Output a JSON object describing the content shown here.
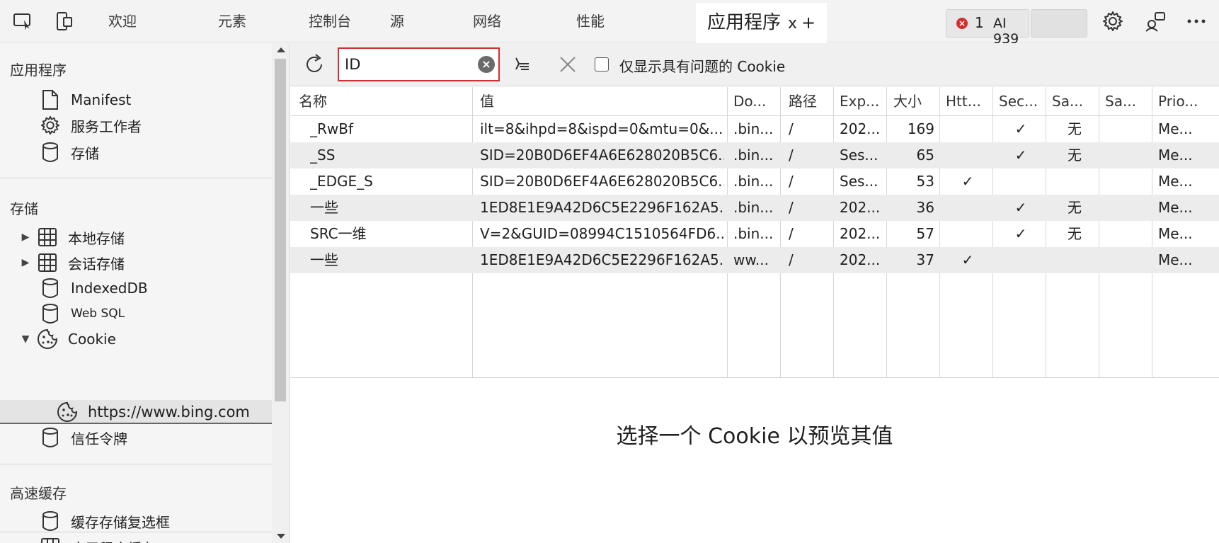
{
  "topbar": {
    "tabs": [
      {
        "label": "欢迎"
      },
      {
        "label": "元素"
      },
      {
        "label": "控制台"
      },
      {
        "label": "源"
      },
      {
        "label": "网络"
      },
      {
        "label": "性能"
      }
    ],
    "active_tab": {
      "label": "应用程序",
      "close": "x",
      "add": "+"
    },
    "errors_count": "1",
    "ai_label": "AI 939",
    "icons": [
      "inspect-icon",
      "device-emulation-icon",
      "error-icon",
      "settings-icon",
      "feedback-icon",
      "more-icon"
    ]
  },
  "sidebar": {
    "app_section": "应用程序",
    "app_items": [
      {
        "label": "Manifest",
        "icon": "file-icon"
      },
      {
        "label": "服务工作者",
        "icon": "gear-icon"
      },
      {
        "label": "存储",
        "icon": "database-icon"
      }
    ],
    "storage_section": "存储",
    "storage_items": [
      {
        "label": "本地存储",
        "icon": "grid-icon",
        "caret": "▶"
      },
      {
        "label": "会话存储",
        "icon": "grid-icon",
        "caret": "▶"
      },
      {
        "label": "IndexedDB",
        "icon": "database-icon"
      },
      {
        "label": "Web SQL",
        "icon": "database-icon"
      },
      {
        "label": "Cookie",
        "icon": "cookie-icon",
        "caret": "▼"
      },
      {
        "label": "https://www.bing.com",
        "icon": "cookie-icon"
      },
      {
        "label": "信任令牌",
        "icon": "database-icon"
      }
    ],
    "cache_section": "高速缓存",
    "cache_items": [
      {
        "label": "缓存存储复选框",
        "icon": "database-icon"
      },
      {
        "label": "应用程序缓存",
        "icon": "grid-icon"
      }
    ]
  },
  "toolbar": {
    "search_value": "ID",
    "clear_icon": "×",
    "checkbox_label": "仅显示具有问题的 Cookie",
    "icons": [
      "refresh-icon",
      "clear-filtered-icon",
      "delete-icon"
    ]
  },
  "table": {
    "headers": [
      "名称",
      "值",
      "Do...",
      "路径",
      "Exp...",
      "大小",
      "Htt...",
      "Sec...",
      "Sa...",
      "Sa...",
      "Prio..."
    ],
    "rows": [
      [
        "_RwBf",
        "ilt=8&ihpd=8&ispd=0&mtu=0&...",
        ".bin...",
        "/",
        "202...",
        "169",
        "",
        "✓",
        "无",
        "",
        "Me..."
      ],
      [
        "_SS",
        "SID=20B0D6EF4A6E628020B5C6...",
        ".bin...",
        "/",
        "Ses...",
        "65",
        "",
        "✓",
        "无",
        "",
        "Me..."
      ],
      [
        "_EDGE_S",
        "SID=20B0D6EF4A6E628020B5C6...",
        ".bin...",
        "/",
        "Ses...",
        "53",
        "✓",
        "",
        "",
        "",
        "Me..."
      ],
      [
        "一些",
        "1ED8E1E9A42D6C5E2296F162A5...",
        ".bin...",
        "/",
        "202...",
        "36",
        "",
        "✓",
        "无",
        "",
        "Me..."
      ],
      [
        "SRC一维",
        "V=2&GUID=08994C1510564FD6...",
        ".bin...",
        "/",
        "202...",
        "57",
        "",
        "✓",
        "无",
        "",
        "Me..."
      ],
      [
        "一些",
        "1ED8E1E9A42D6C5E2296F162A5...",
        "ww...",
        "/",
        "202...",
        "37",
        "✓",
        "",
        "",
        "",
        "Me..."
      ]
    ]
  },
  "preview": {
    "empty_message": "选择一个 Cookie 以预览其值"
  }
}
